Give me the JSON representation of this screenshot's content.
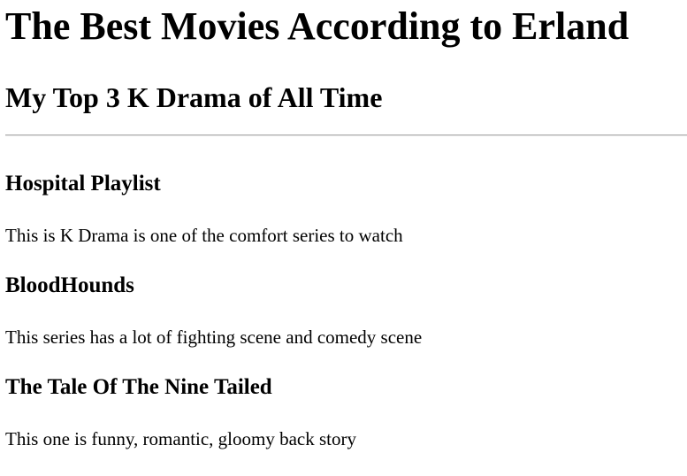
{
  "page": {
    "title": "The Best Movies According to Erland",
    "subtitle": "My Top 3 K Drama of All Time"
  },
  "entries": [
    {
      "title": "Hospital Playlist",
      "description": "This is K Drama is one of the comfort series to watch"
    },
    {
      "title": "BloodHounds",
      "description": "This series has a lot of fighting scene and comedy scene"
    },
    {
      "title": "The Tale Of The Nine Tailed",
      "description": "This one is funny, romantic, gloomy back story"
    }
  ]
}
